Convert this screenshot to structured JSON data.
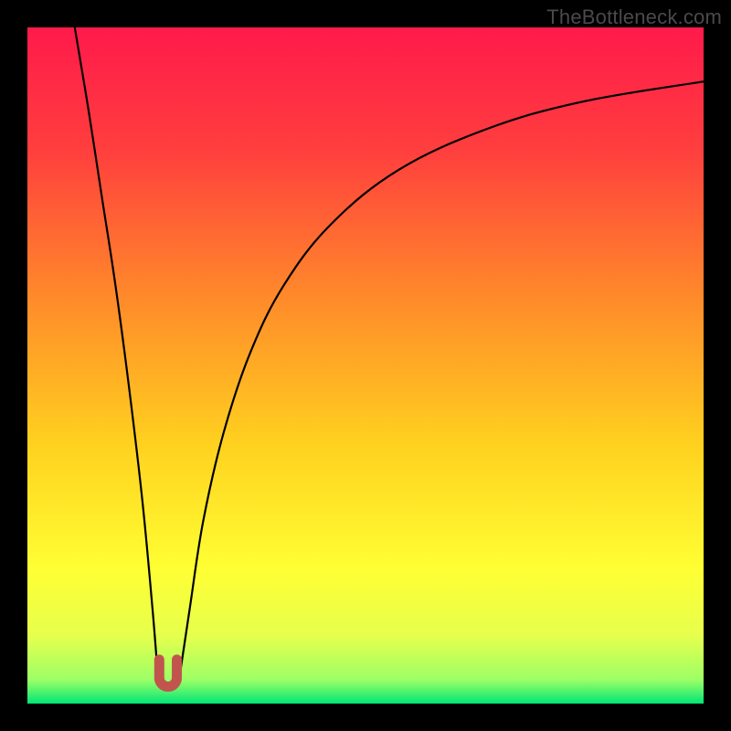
{
  "watermark": {
    "text": "TheBottleneck.com"
  },
  "colors": {
    "frame": "#000000",
    "curve": "#000000",
    "marker": "#C1554E",
    "gradient_stops": [
      {
        "offset": 0.0,
        "color": "#FF1A4B"
      },
      {
        "offset": 0.18,
        "color": "#FF3E3E"
      },
      {
        "offset": 0.4,
        "color": "#FF8A2A"
      },
      {
        "offset": 0.62,
        "color": "#FFD21F"
      },
      {
        "offset": 0.8,
        "color": "#FFFF33"
      },
      {
        "offset": 0.9,
        "color": "#E6FF4D"
      },
      {
        "offset": 0.965,
        "color": "#9CFF66"
      },
      {
        "offset": 1.0,
        "color": "#00E676"
      }
    ]
  },
  "chart_data": {
    "type": "line",
    "title": "",
    "xlabel": "",
    "ylabel": "",
    "xlim": [
      0,
      100
    ],
    "ylim": [
      0,
      100
    ],
    "series": [
      {
        "name": "bottleneck-curve-left",
        "x": [
          7,
          9,
          11,
          13,
          15,
          17,
          18.5,
          19.3
        ],
        "y": [
          100,
          88,
          75,
          62,
          47,
          30,
          14,
          4
        ]
      },
      {
        "name": "bottleneck-curve-right",
        "x": [
          22.5,
          24,
          26,
          29,
          33,
          38,
          45,
          55,
          68,
          82,
          100
        ],
        "y": [
          4,
          14,
          27,
          40,
          52,
          62,
          71,
          79,
          85,
          89,
          92
        ]
      }
    ],
    "marker": {
      "name": "optimal-point",
      "shape": "U",
      "x": 20.8,
      "y": 2.5,
      "width_x": 2.6,
      "height_y": 4.0
    }
  }
}
